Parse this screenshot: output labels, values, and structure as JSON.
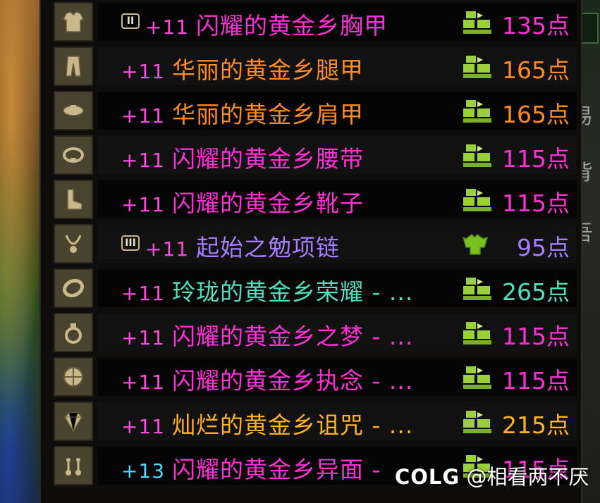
{
  "colors": {
    "magenta": "#ff2fd8",
    "orange": "#ff8a1e",
    "purple": "#a87cff",
    "cyan": "#4fe0c0",
    "gold": "#ffb21e",
    "upgrade_magenta": "#ff4ae0",
    "upgrade_cyan": "#4fd8ff",
    "trade_green": "#9ad03a"
  },
  "items": [
    {
      "icon": "chest-armor-icon",
      "tag": "II",
      "upgrade": "+11",
      "name": "闪耀的黄金乡胸甲",
      "points": "135点",
      "name_color": "#ff2fd8",
      "points_color": "#ff2fd8",
      "upgrade_color": "#ff4ae0",
      "trade_icon": "tradable-icon"
    },
    {
      "icon": "leg-armor-icon",
      "tag": "",
      "upgrade": "+11",
      "name": "华丽的黄金乡腿甲",
      "points": "165点",
      "name_color": "#ff8a1e",
      "points_color": "#ff8a1e",
      "upgrade_color": "#ff4ae0",
      "trade_icon": "tradable-icon"
    },
    {
      "icon": "shoulder-armor-icon",
      "tag": "",
      "upgrade": "+11",
      "name": "华丽的黄金乡肩甲",
      "points": "165点",
      "name_color": "#ff8a1e",
      "points_color": "#ff8a1e",
      "upgrade_color": "#ff4ae0",
      "trade_icon": "tradable-icon"
    },
    {
      "icon": "belt-icon",
      "tag": "",
      "upgrade": "+11",
      "name": "闪耀的黄金乡腰带",
      "points": "115点",
      "name_color": "#ff2fd8",
      "points_color": "#ff2fd8",
      "upgrade_color": "#ff4ae0",
      "trade_icon": "tradable-icon"
    },
    {
      "icon": "boots-icon",
      "tag": "",
      "upgrade": "+11",
      "name": "闪耀的黄金乡靴子",
      "points": "115点",
      "name_color": "#ff2fd8",
      "points_color": "#ff2fd8",
      "upgrade_color": "#ff4ae0",
      "trade_icon": "tradable-icon"
    },
    {
      "icon": "necklace-icon",
      "tag": "III",
      "upgrade": "+11",
      "name": "起始之勉项链",
      "points": "95点",
      "name_color": "#a87cff",
      "points_color": "#a87cff",
      "upgrade_color": "#ff4ae0",
      "trade_icon": "account-bound-icon"
    },
    {
      "icon": "bracelet-icon",
      "tag": "",
      "upgrade": "+11",
      "name": "玲珑的黄金乡荣耀 - ...",
      "points": "265点",
      "name_color": "#4fe0c0",
      "points_color": "#4fe0c0",
      "upgrade_color": "#ff4ae0",
      "trade_icon": "tradable-icon"
    },
    {
      "icon": "ring-icon",
      "tag": "",
      "upgrade": "+11",
      "name": "闪耀的黄金乡之梦 - ...",
      "points": "115点",
      "name_color": "#ff2fd8",
      "points_color": "#ff2fd8",
      "upgrade_color": "#ff4ae0",
      "trade_icon": "tradable-icon"
    },
    {
      "icon": "orb-icon",
      "tag": "",
      "upgrade": "+11",
      "name": "闪耀的黄金乡执念 - ...",
      "points": "115点",
      "name_color": "#ff2fd8",
      "points_color": "#ff2fd8",
      "upgrade_color": "#ff4ae0",
      "trade_icon": "tradable-icon"
    },
    {
      "icon": "gem-icon",
      "tag": "",
      "upgrade": "+11",
      "name": "灿烂的黄金乡诅咒 - ...",
      "points": "215点",
      "name_color": "#ffb21e",
      "points_color": "#ffb21e",
      "upgrade_color": "#ff4ae0",
      "trade_icon": "tradable-icon"
    },
    {
      "icon": "earring-icon",
      "tag": "",
      "upgrade": "+13",
      "name": "闪耀的黄金乡异面 -",
      "points": "115点",
      "name_color": "#ff2fd8",
      "points_color": "#ff2fd8",
      "upgrade_color": "#4fd8ff",
      "trade_icon": "tradable-icon"
    }
  ],
  "watermark": {
    "logo": "COLG",
    "handle": "@相看两不厌"
  },
  "side_glyphs": [
    "易",
    "背",
    "吾"
  ]
}
